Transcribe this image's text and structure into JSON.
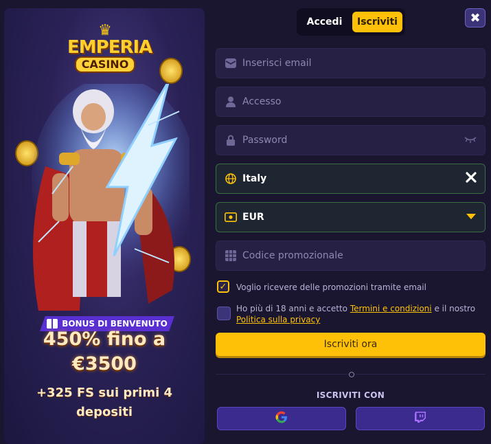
{
  "brand": {
    "logo_line1": "EMPERIA",
    "logo_line2": "CASINO"
  },
  "promo": {
    "badge": "BONUS DI BENVENUTO",
    "line1": "450% fino a",
    "line2": "€3500",
    "line3": "+325 FS sui primi 4",
    "line4": "depositi"
  },
  "tabs": {
    "login": "Accedi",
    "register": "Iscriviti"
  },
  "close_label": "✖",
  "form": {
    "email_placeholder": "Inserisci email",
    "login_placeholder": "Accesso",
    "password_placeholder": "Password",
    "country_value": "Italy",
    "currency_value": "EUR",
    "promo_placeholder": "Codice promozionale"
  },
  "consents": {
    "promotions": "Voglio ricevere delle promozioni tramite email",
    "age_prefix": "Ho più di 18 anni e accetto",
    "terms_link": "Termini e condizioni",
    "age_middle": "e il nostro",
    "privacy_link": "Politica sulla privacy",
    "promotions_checked": true,
    "age_checked": false
  },
  "submit_label": "Iscriviti ora",
  "social": {
    "heading": "ISCRIVITI CON",
    "providers": [
      "google-icon",
      "twitch-icon"
    ]
  },
  "colors": {
    "accent": "#ffc107",
    "background": "#1a1630",
    "valid_border": "#3c6c42",
    "social_button": "#3b2b8f"
  }
}
